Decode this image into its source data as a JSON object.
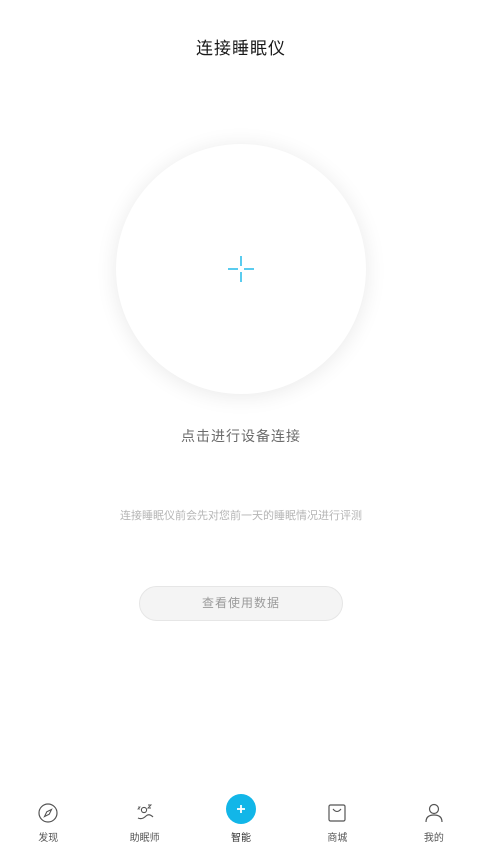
{
  "header": {
    "title": "连接睡眠仪"
  },
  "connect": {
    "icon": "crosshair-icon",
    "hint": "点击进行设备连接",
    "note": "连接睡眠仪前会先对您前一天的睡眠情况进行评测"
  },
  "actions": {
    "view_data_label": "查看使用数据"
  },
  "tabs": [
    {
      "label": "发现",
      "icon": "compass-icon",
      "active": false
    },
    {
      "label": "助眠师",
      "icon": "sleeping-person-icon",
      "active": false
    },
    {
      "label": "智能",
      "icon": "plus-icon",
      "active": true
    },
    {
      "label": "商城",
      "icon": "shopping-bag-icon",
      "active": false
    },
    {
      "label": "我的",
      "icon": "person-icon",
      "active": false
    }
  ],
  "colors": {
    "accent": "#12b6e8",
    "background": "#ffffff",
    "hint_text": "#6b6b6b",
    "note_text": "#b5b5b5"
  }
}
